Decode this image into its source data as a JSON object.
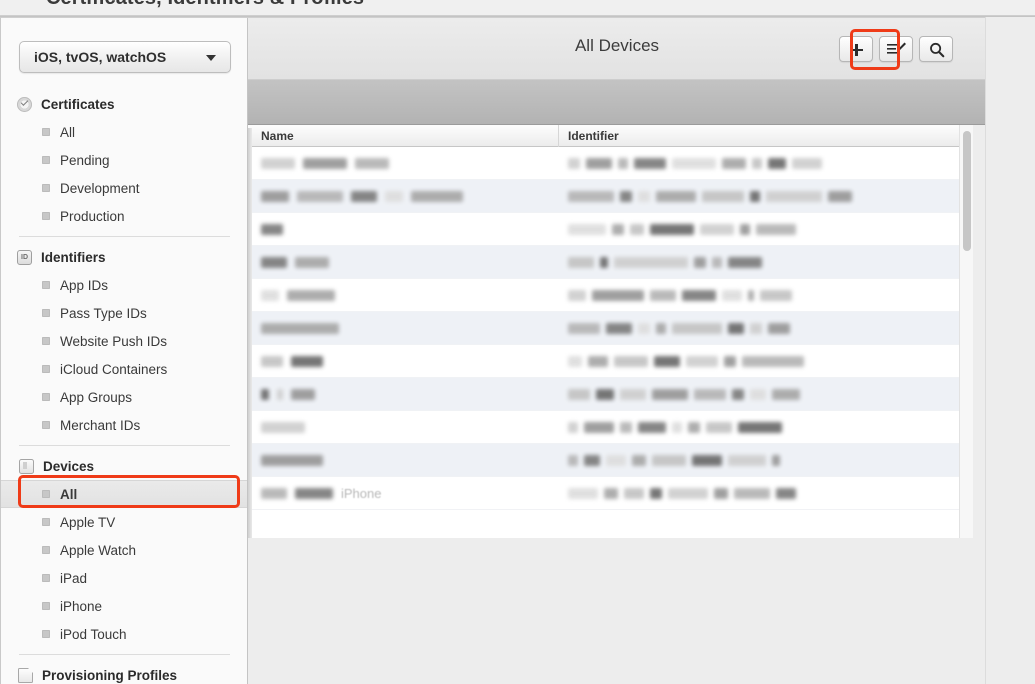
{
  "page": {
    "title": "Certificates, Identifiers & Profiles"
  },
  "sidebar": {
    "platform_select": {
      "value": "iOS, tvOS, watchOS",
      "icon": "chevron-down-icon"
    },
    "sections": [
      {
        "id": "certificates",
        "label": "Certificates",
        "icon": "certificate-badge-icon",
        "items": [
          {
            "label": "All",
            "selected": false
          },
          {
            "label": "Pending",
            "selected": false
          },
          {
            "label": "Development",
            "selected": false
          },
          {
            "label": "Production",
            "selected": false
          }
        ]
      },
      {
        "id": "identifiers",
        "label": "Identifiers",
        "icon": "id-badge-icon",
        "items": [
          {
            "label": "App IDs",
            "selected": false
          },
          {
            "label": "Pass Type IDs",
            "selected": false
          },
          {
            "label": "Website Push IDs",
            "selected": false
          },
          {
            "label": "iCloud Containers",
            "selected": false
          },
          {
            "label": "App Groups",
            "selected": false
          },
          {
            "label": "Merchant IDs",
            "selected": false
          }
        ]
      },
      {
        "id": "devices",
        "label": "Devices",
        "icon": "device-phone-icon",
        "items": [
          {
            "label": "All",
            "selected": true
          },
          {
            "label": "Apple TV",
            "selected": false
          },
          {
            "label": "Apple Watch",
            "selected": false
          },
          {
            "label": "iPad",
            "selected": false
          },
          {
            "label": "iPhone",
            "selected": false
          },
          {
            "label": "iPod Touch",
            "selected": false
          }
        ]
      },
      {
        "id": "provisioning-profiles",
        "label": "Provisioning Profiles",
        "icon": "document-page-icon",
        "items": []
      }
    ]
  },
  "toolbar": {
    "title": "All Devices",
    "buttons": [
      {
        "id": "add",
        "icon": "plus-icon",
        "label": "+"
      },
      {
        "id": "edit",
        "icon": "edit-list-pencil-icon",
        "label": ""
      },
      {
        "id": "search",
        "icon": "search-magnifier-icon",
        "label": ""
      }
    ]
  },
  "table": {
    "columns": [
      {
        "key": "name",
        "label": "Name"
      },
      {
        "key": "identifier",
        "label": "Identifier"
      }
    ],
    "rows": [
      {
        "name": "",
        "identifier": "",
        "redacted": true,
        "name_blocks": [
          34,
          44,
          34
        ],
        "id_blocks": [
          12,
          26,
          10,
          32,
          44,
          24,
          10,
          18,
          30
        ]
      },
      {
        "name": "",
        "identifier": "",
        "redacted": true,
        "name_blocks": [
          28,
          46,
          26,
          18,
          52
        ],
        "id_blocks": [
          46,
          12,
          12,
          40,
          42,
          10,
          56,
          24
        ]
      },
      {
        "name": "",
        "identifier": "",
        "redacted": true,
        "name_blocks": [
          0,
          22
        ],
        "id_blocks": [
          38,
          12,
          14,
          44,
          34,
          10,
          40
        ]
      },
      {
        "name": "",
        "identifier": "",
        "redacted": true,
        "name_blocks": [
          26,
          0,
          34
        ],
        "id_blocks": [
          26,
          8,
          74,
          12,
          10,
          34
        ]
      },
      {
        "name": "",
        "identifier": "",
        "redacted": true,
        "name_blocks": [
          18,
          48
        ],
        "id_blocks": [
          18,
          52,
          26,
          34,
          20,
          6,
          32
        ]
      },
      {
        "name": "",
        "identifier": "",
        "redacted": true,
        "name_blocks": [
          78
        ],
        "id_blocks": [
          32,
          26,
          12,
          10,
          50,
          16,
          12,
          22
        ]
      },
      {
        "name": "",
        "identifier": "",
        "redacted": true,
        "name_blocks": [
          22,
          32
        ],
        "id_blocks": [
          14,
          20,
          34,
          26,
          32,
          12,
          62
        ]
      },
      {
        "name": "",
        "identifier": "",
        "redacted": true,
        "name_blocks": [
          8,
          6,
          24
        ],
        "id_blocks": [
          22,
          18,
          26,
          36,
          32,
          12,
          16,
          28
        ]
      },
      {
        "name": "",
        "identifier": "",
        "redacted": true,
        "name_blocks": [
          44
        ],
        "id_blocks": [
          10,
          30,
          12,
          28,
          10,
          12,
          26,
          44
        ]
      },
      {
        "name": "",
        "identifier": "",
        "redacted": true,
        "name_blocks": [
          62
        ],
        "id_blocks": [
          10,
          16,
          20,
          14,
          34,
          30,
          38,
          8
        ]
      },
      {
        "name": "iPhone",
        "identifier": "",
        "redacted": true,
        "name_blocks": [
          26,
          38
        ],
        "id_blocks": [
          30,
          14,
          20,
          12,
          40,
          14,
          36,
          20
        ]
      }
    ]
  },
  "annotations": [
    {
      "id": "add-button-highlight",
      "target": "add-button",
      "color": "#ef3b18"
    },
    {
      "id": "devices-all-highlight",
      "target": "sidebar-item-devices-all",
      "color": "#ef3b18"
    }
  ],
  "colors": {
    "annotation": "#ef3b18",
    "row_even": "#eef1f6",
    "row_odd": "#ffffff",
    "toolbar_bg": "#e6e6e6",
    "sidebar_bg": "#fafafa"
  }
}
